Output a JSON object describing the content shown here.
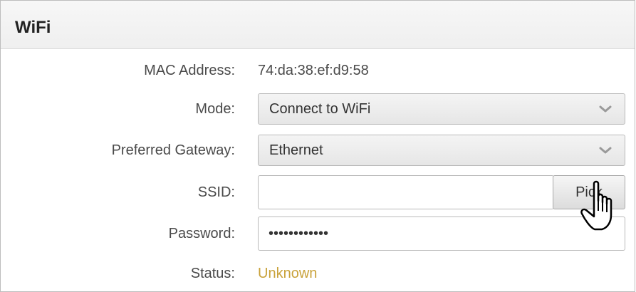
{
  "panel": {
    "title": "WiFi"
  },
  "fields": {
    "mac_label": "MAC Address:",
    "mac_value": "74:da:38:ef:d9:58",
    "mode_label": "Mode:",
    "mode_value": "Connect to WiFi",
    "gateway_label": "Preferred Gateway:",
    "gateway_value": "Ethernet",
    "ssid_label": "SSID:",
    "ssid_value": "",
    "pick_label": "Pick",
    "password_label": "Password:",
    "password_mask": "••••••••••••",
    "status_label": "Status:",
    "status_value": "Unknown"
  },
  "icons": {
    "select_arrow": "chevron-down-icon",
    "cursor": "hand-pointer-icon"
  },
  "colors": {
    "status_unknown": "#c9a23a"
  }
}
